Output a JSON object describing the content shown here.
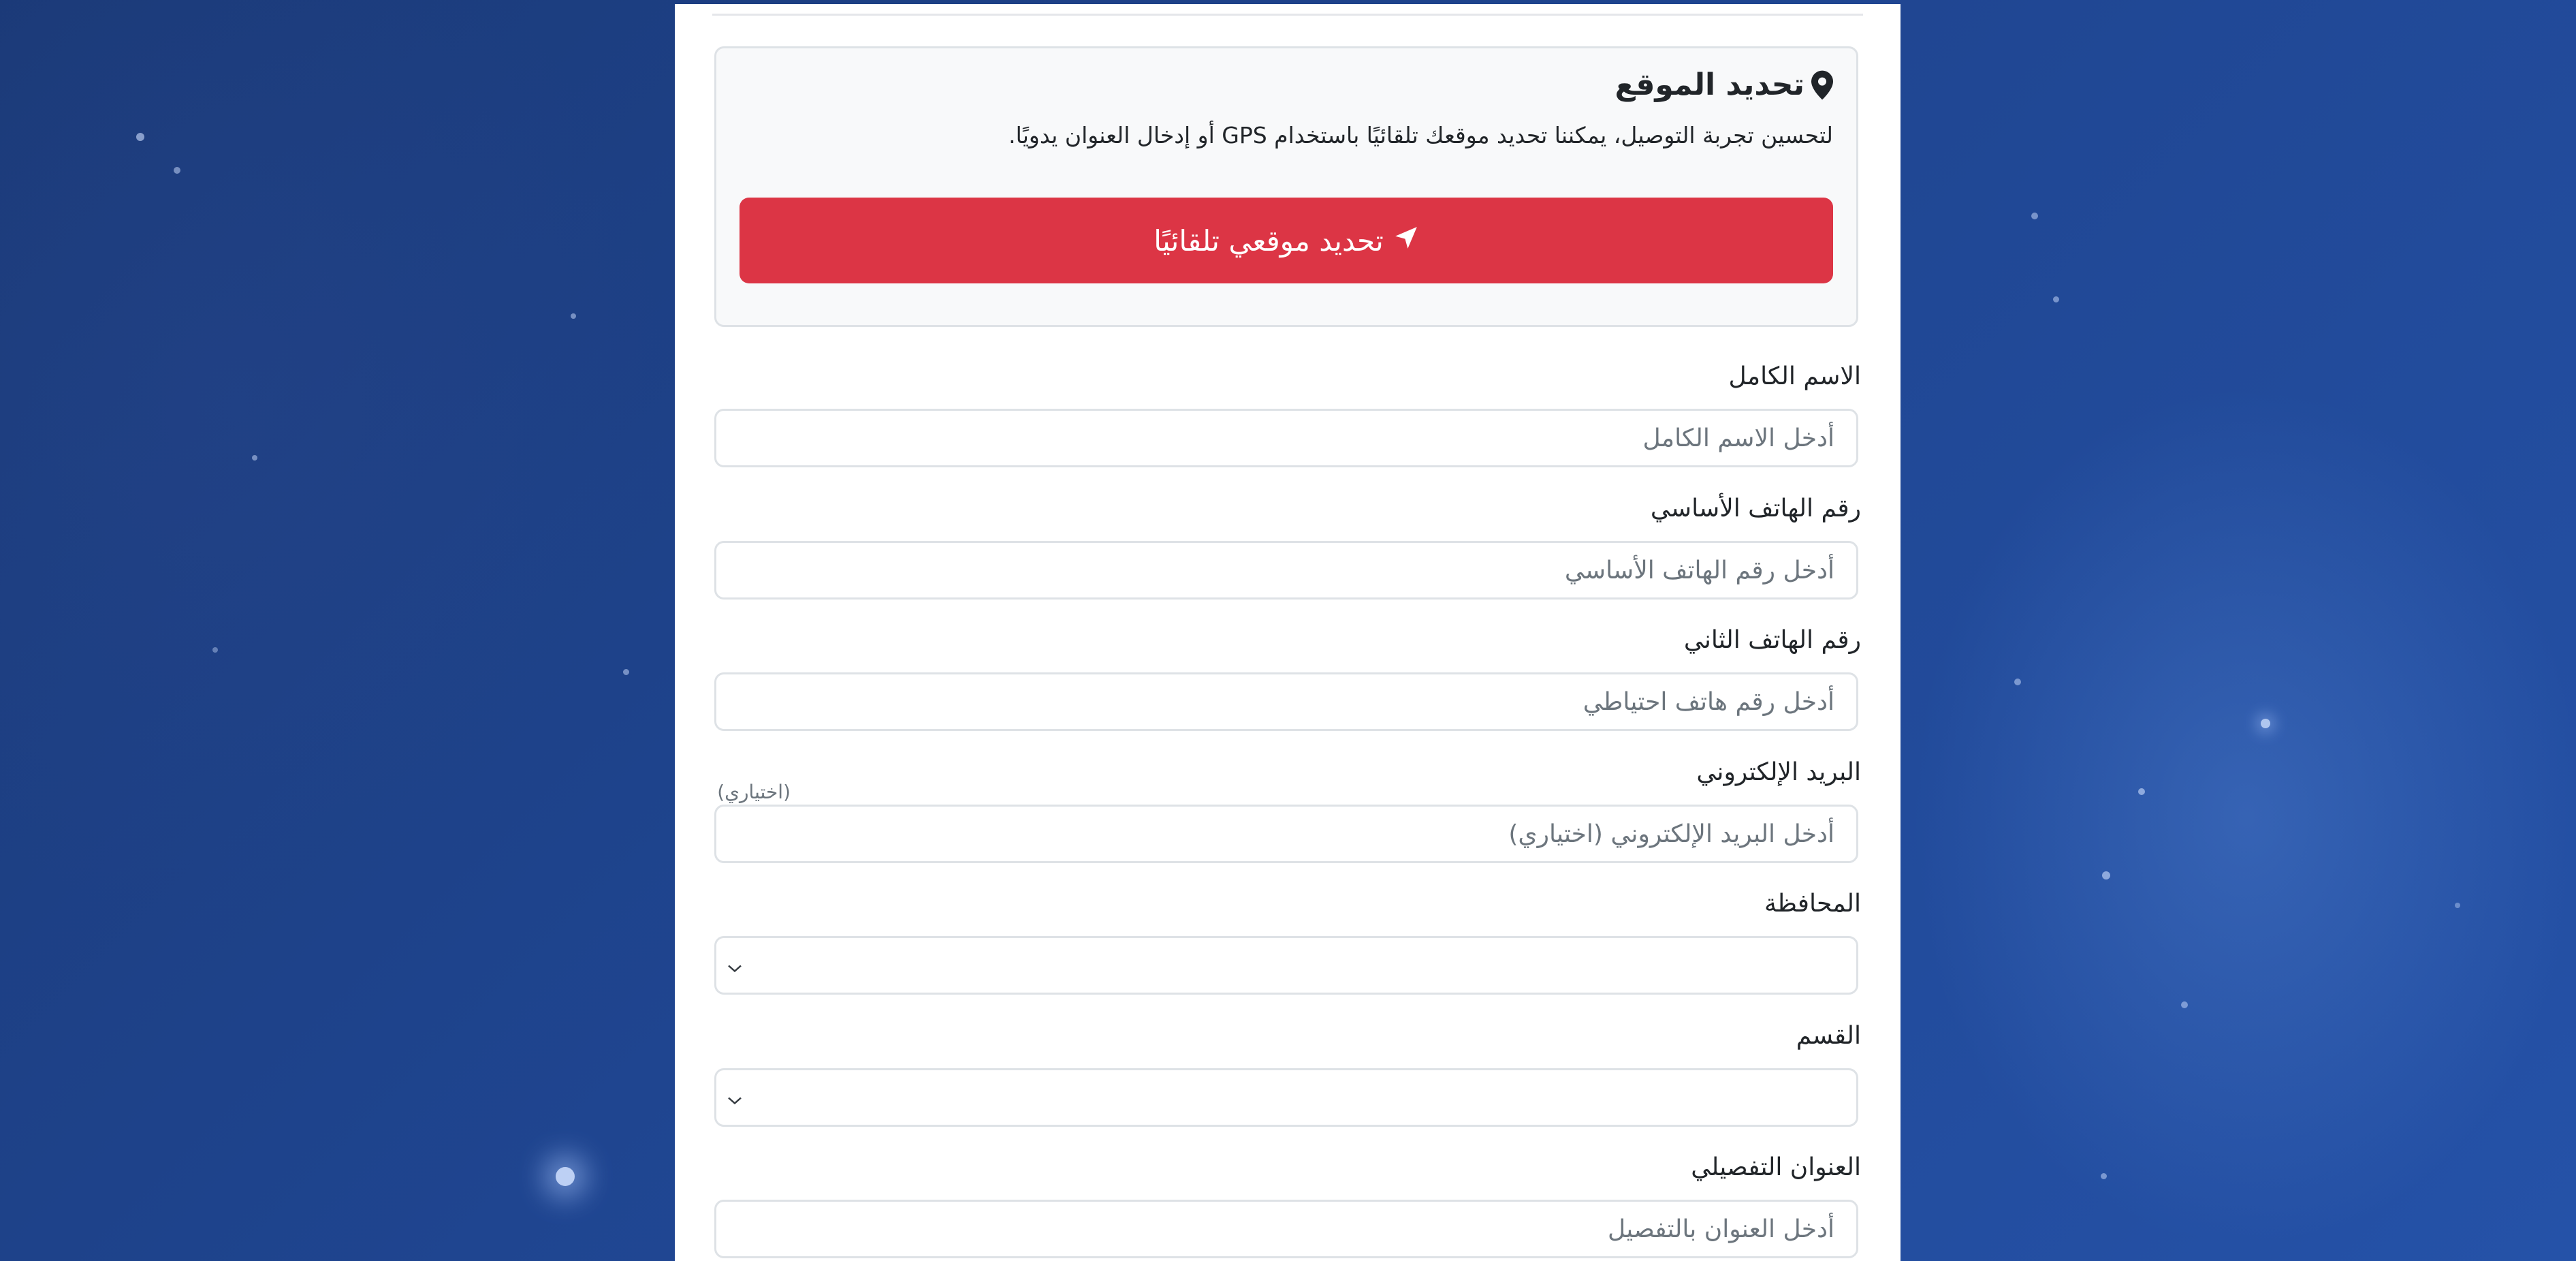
{
  "location": {
    "title": "تحديد الموقع",
    "description": "لتحسين تجربة التوصيل، يمكننا تحديد موقعك تلقائيًا باستخدام GPS أو إدخال العنوان يدويًا.",
    "gps_button_label": "تحديد موقعي تلقائيًا",
    "pin_icon": "map-pin-icon",
    "arrow_icon": "location-arrow-icon"
  },
  "form": {
    "full_name": {
      "label": "الاسم الكامل",
      "placeholder": "أدخل الاسم الكامل"
    },
    "primary_phone": {
      "label": "رقم الهاتف الأساسي",
      "placeholder": "أدخل رقم الهاتف الأساسي"
    },
    "secondary_phone": {
      "label": "رقم الهاتف الثاني",
      "placeholder": "أدخل رقم هاتف احتياطي"
    },
    "email": {
      "label": "البريد الإلكتروني",
      "sublabel": "(اختياري)",
      "placeholder": "أدخل البريد الإلكتروني (اختياري)"
    },
    "governorate": {
      "label": "المحافظة",
      "value": ""
    },
    "district": {
      "label": "القسم",
      "value": ""
    },
    "address": {
      "label": "العنوان التفصيلي",
      "placeholder": "أدخل العنوان بالتفصيل"
    }
  },
  "colors": {
    "primary_button": "#dc3545",
    "background": "#1f4590"
  }
}
